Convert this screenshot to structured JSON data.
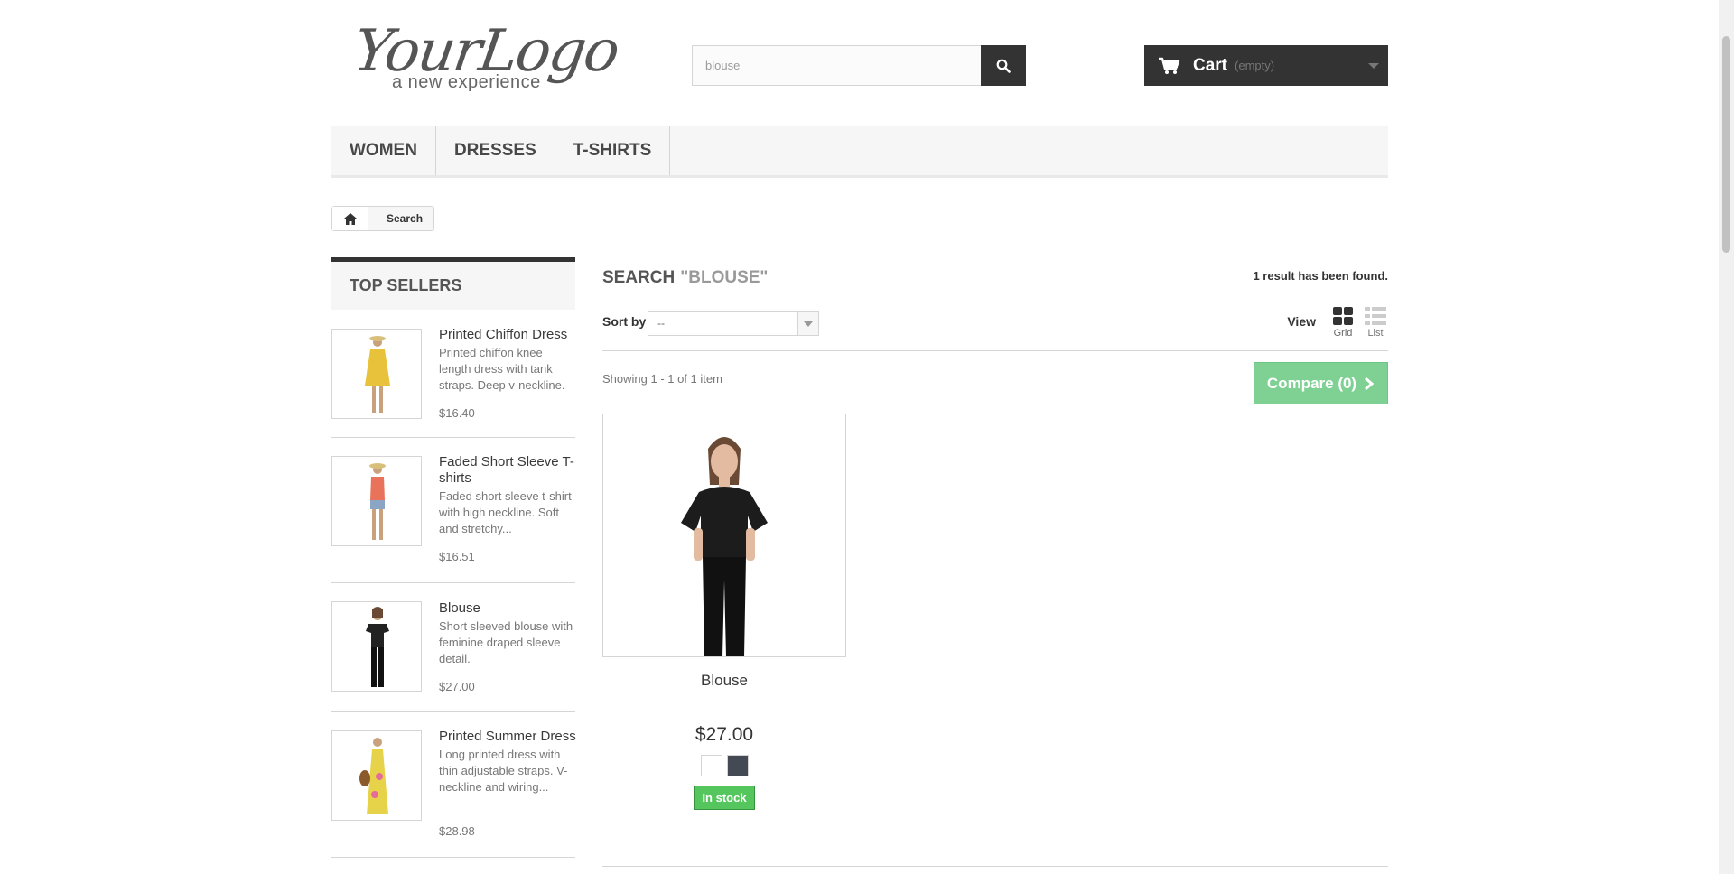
{
  "header": {
    "logo_text": "YourLogo",
    "logo_tagline": "a new experience",
    "search_value": "blouse",
    "search_icon": "search-icon",
    "cart_label": "Cart",
    "cart_status": "(empty)"
  },
  "menu": {
    "items": [
      {
        "label": "WOMEN"
      },
      {
        "label": "DRESSES"
      },
      {
        "label": "T-SHIRTS"
      }
    ]
  },
  "breadcrumb": {
    "current": "Search"
  },
  "top_sellers": {
    "title": "TOP SELLERS",
    "items": [
      {
        "name": "Printed Chiffon Dress",
        "desc": "Printed chiffon knee length dress with tank straps. Deep v-neckline.",
        "price": "$16.40",
        "color": "#e8c23a"
      },
      {
        "name": "Faded Short Sleeve T-shirts",
        "desc": "Faded short sleeve t-shirt with high neckline. Soft and stretchy...",
        "price": "$16.51",
        "color": "#e9735a"
      },
      {
        "name": "Blouse",
        "desc": "Short sleeved blouse with feminine draped sleeve detail.",
        "price": "$27.00",
        "color": "#222222"
      },
      {
        "name": "Printed Summer Dress",
        "desc": "Long printed dress with thin adjustable straps. V-neckline and wiring...",
        "price": "$28.98",
        "color": "#e7d34a"
      }
    ]
  },
  "results": {
    "heading": "SEARCH",
    "query": "\"BLOUSE\"",
    "found_text": "1 result has been found.",
    "sort_label": "Sort by",
    "sort_value": "--",
    "view_label": "View",
    "view_grid": "Grid",
    "view_list": "List",
    "showing": "Showing 1 - 1 of 1 item",
    "compare_label": "Compare (0)",
    "product": {
      "name": "Blouse",
      "price": "$27.00",
      "stock": "In stock",
      "swatches": [
        "#ffffff",
        "#434a54"
      ]
    }
  },
  "colors": {
    "dark": "#333333",
    "compare_green": "#7ed093",
    "stock_green": "#55c65e"
  }
}
